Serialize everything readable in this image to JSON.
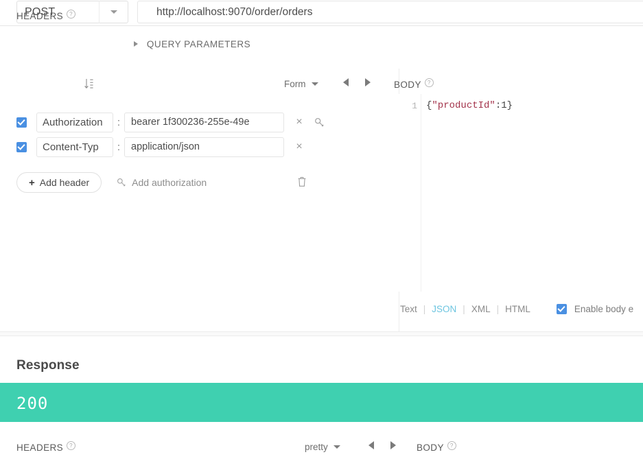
{
  "request": {
    "method": "POST",
    "url": "http://localhost:9070/order/orders",
    "query_parameters_label": "QUERY PARAMETERS",
    "headers_section": {
      "title": "HEADERS",
      "help": "?",
      "sort_icon": "sort-alpha-asc-icon",
      "view_mode": "Form",
      "rows": [
        {
          "enabled": true,
          "key": "Authorization",
          "separator": ":",
          "value": "bearer 1f300236-255e-49e",
          "remove": "×",
          "extra_icon": "key-icon"
        },
        {
          "enabled": true,
          "key": "Content-Typ",
          "separator": ":",
          "value": "application/json",
          "remove": "×"
        }
      ],
      "add_header_label": "Add header",
      "add_header_plus": "+",
      "add_authorization_label": "Add authorization",
      "delete_all_icon": "trash-icon"
    },
    "body_section": {
      "title": "BODY",
      "help": "?",
      "line_number": "1",
      "code_tokens": [
        {
          "text": "{",
          "type": "punc"
        },
        {
          "text": "\"productId\"",
          "type": "str"
        },
        {
          "text": ":",
          "type": "punc"
        },
        {
          "text": "1",
          "type": "num"
        },
        {
          "text": "}",
          "type": "punc"
        }
      ],
      "code_plain": "{\"productId\":1}",
      "formats": [
        "Text",
        "JSON",
        "XML",
        "HTML"
      ],
      "active_format": "JSON",
      "separator": "|",
      "enable_body_label": "Enable body e",
      "enable_body_checked": true
    }
  },
  "response": {
    "title": "Response",
    "status_code": "200",
    "status_color": "#3fd0b0",
    "headers_section": {
      "title": "HEADERS",
      "help": "?"
    },
    "view_mode": "pretty",
    "body_section": {
      "title": "BODY",
      "help": "?"
    }
  },
  "colors": {
    "accent_blue": "#4a90e2",
    "status_teal": "#3fd0b0",
    "format_active": "#6dc5e0",
    "string_token": "#a3334b"
  }
}
